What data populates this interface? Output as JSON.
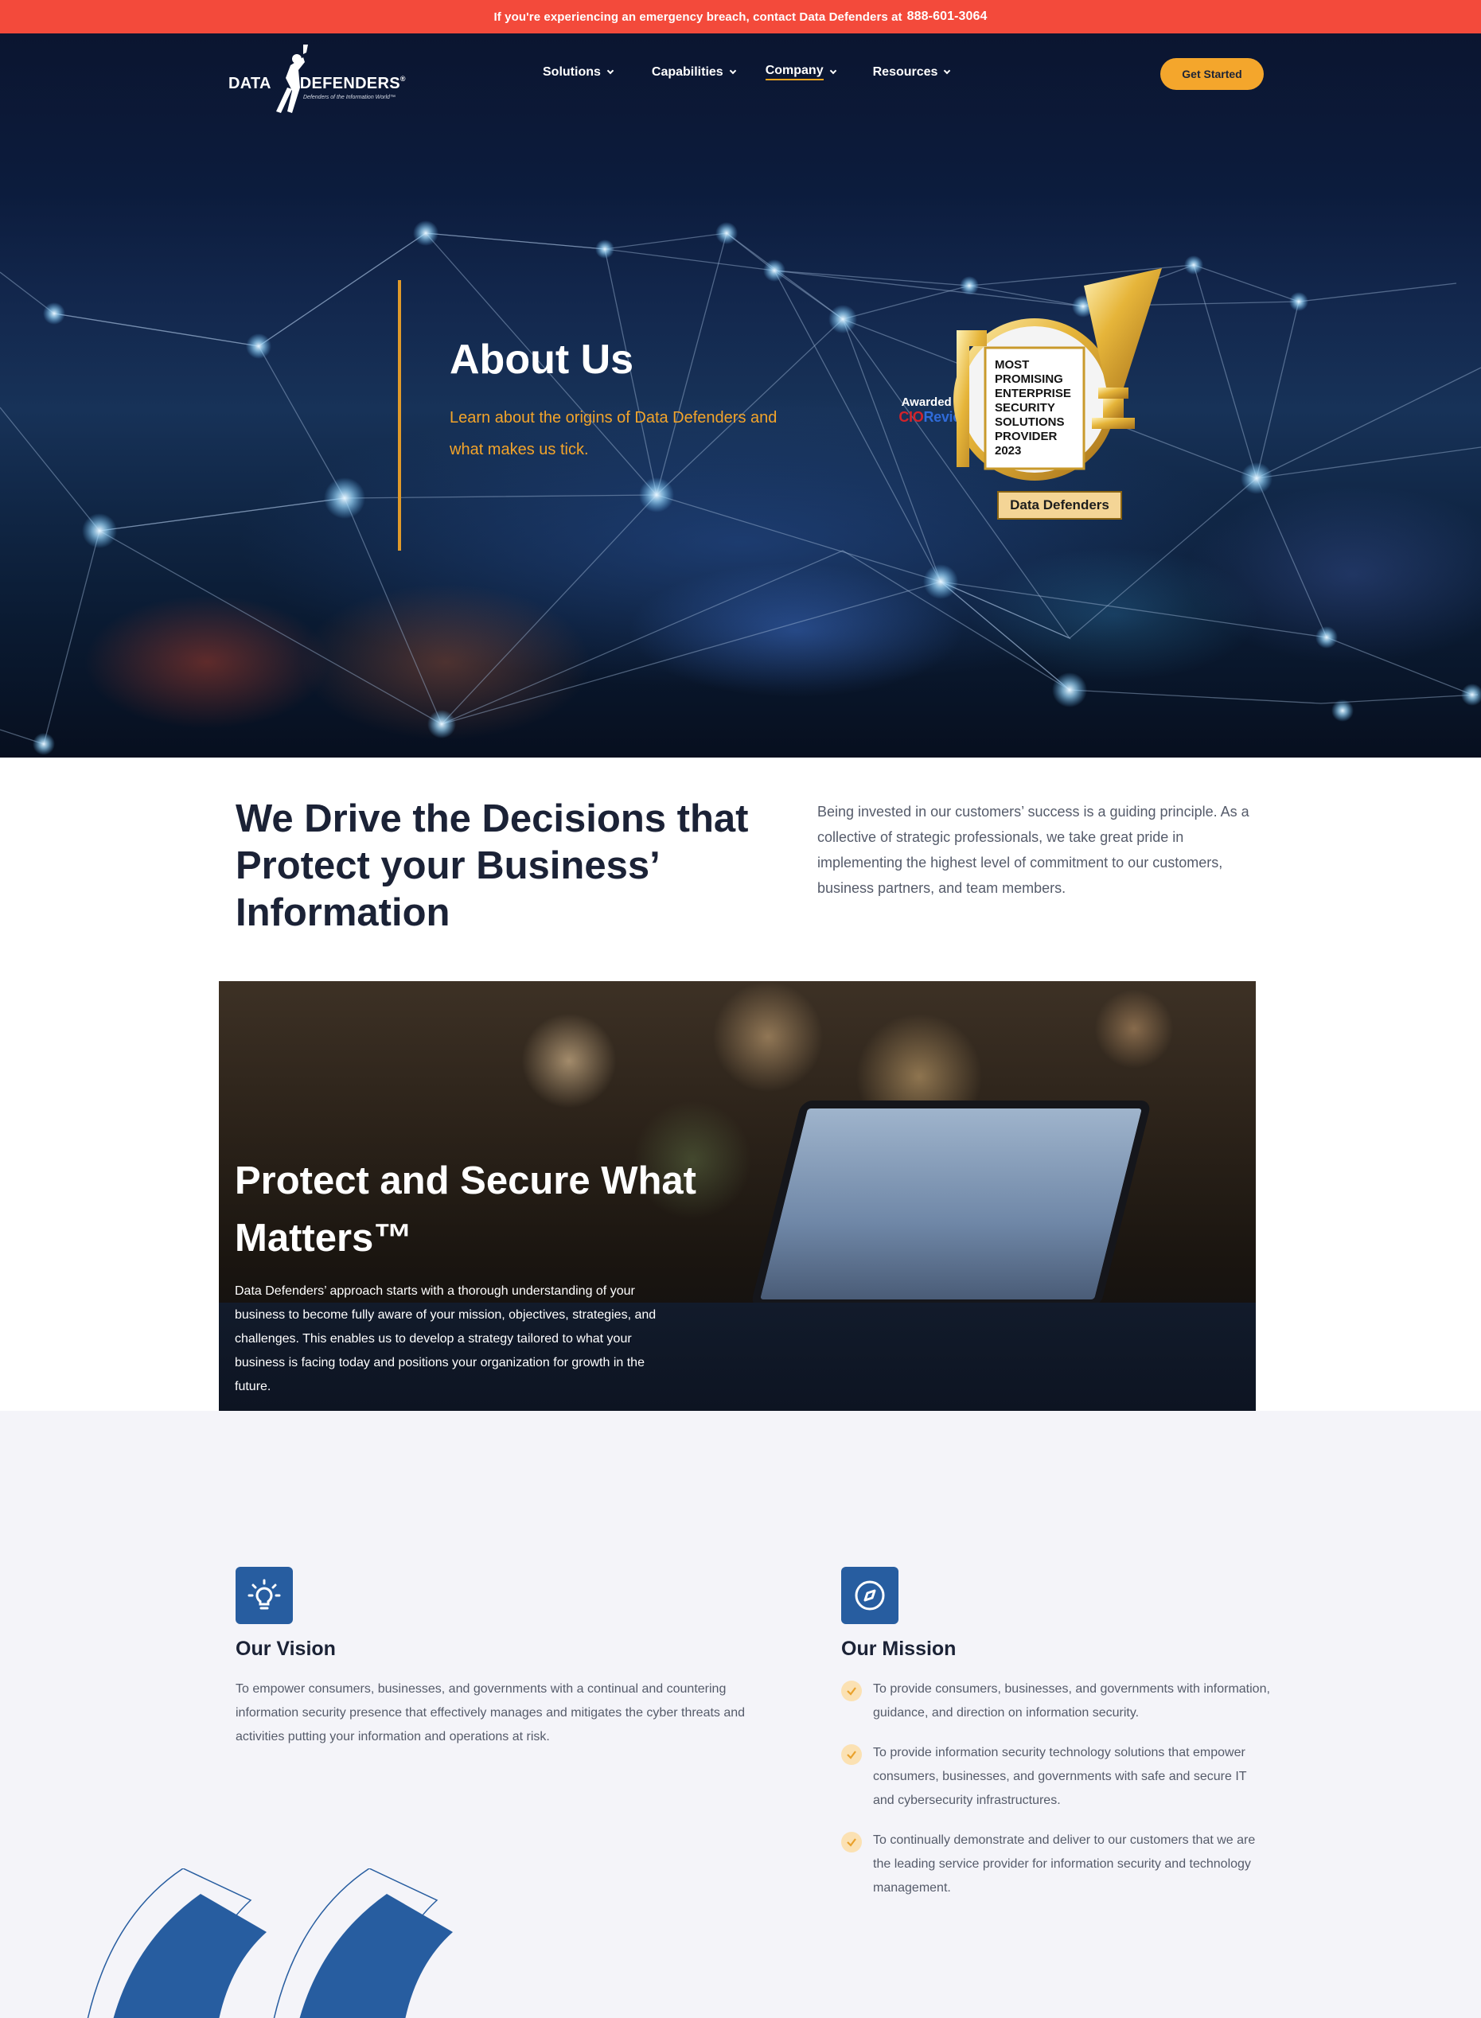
{
  "alert": {
    "text": "If you're experiencing an emergency breach, contact Data Defenders at",
    "phone": "888-601-3064"
  },
  "logo": {
    "word1": "DATA",
    "word2": "DEFENDERS",
    "reg": "®",
    "tagline": "Defenders of the Information World™"
  },
  "nav": {
    "items": [
      {
        "label": "Solutions"
      },
      {
        "label": "Capabilities"
      },
      {
        "label": "Company",
        "active": true
      },
      {
        "label": "Resources"
      }
    ],
    "cta": "Get Started"
  },
  "hero": {
    "title": "About Us",
    "subtitle": "Learn about the origins of Data Defenders and what makes us tick."
  },
  "award": {
    "awarded_by": "Awarded by",
    "brand_part1": "CIO",
    "brand_part2": "Review",
    "lines": [
      "MOST",
      "PROMISING",
      "ENTERPRISE",
      "SECURITY",
      "SOLUTIONS",
      "PROVIDER",
      "2023"
    ],
    "plate": "Data Defenders"
  },
  "intro": {
    "heading": "We Drive the Decisions that Protect your Business’ Information",
    "text": "Being invested in our customers’ success is a guiding principle. As a collective of strategic professionals, we take great pride in implementing the highest level of commitment to our customers, business partners, and team members."
  },
  "protect": {
    "title": "Protect and Secure What Matters™",
    "text": "Data Defenders’ approach starts with a thorough understanding of your business to become fully aware of your mission, objectives, strategies, and challenges. This enables us to develop a strategy tailored to what your business is facing today and positions your organization for growth in the future."
  },
  "vision": {
    "icon": "lightbulb-icon",
    "title": "Our Vision",
    "text": "To empower consumers, businesses, and governments with a continual and countering information security presence that effectively manages and mitigates the cyber threats and activities putting your information and operations at risk."
  },
  "mission": {
    "icon": "compass-icon",
    "title": "Our Mission",
    "items": [
      "To provide consumers, businesses, and governments with information, guidance, and direction on information security.",
      "To provide information security technology solutions that empower consumers, businesses, and governments with safe and secure IT and cybersecurity infrastructures.",
      "To continually demonstrate and deliver to our customers that we are the leading service provider for information security and technology management."
    ]
  },
  "colors": {
    "alert": "#f34a3b",
    "accent": "#f4a62c",
    "brand_blue": "#275da0",
    "heading": "#1b2236",
    "body_text": "#555b6a"
  }
}
